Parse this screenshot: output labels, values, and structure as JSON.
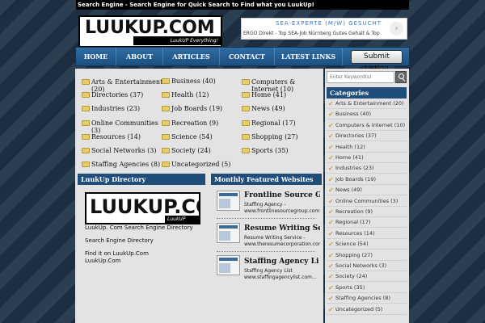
{
  "topbar": {
    "text": "Search Engine - Search Engine for Quick Search to Find what you LuukUp!"
  },
  "logo": {
    "text": "LUUKUP.COM",
    "tagline": "LuukUP Everything!"
  },
  "ad": {
    "title": "SEA-EXPERTE (M/W) GESUCHT",
    "text": "ERGO Direkt - Top SEA-Job Nürnberg Gutes Gehalt & Top Herau...",
    "arrow_icon": "chevron-right-icon"
  },
  "nav": {
    "items": [
      "HOME",
      "ABOUT",
      "ARTICLES",
      "CONTACT",
      "LATEST LINKS"
    ],
    "submit_label": "Submit Listing"
  },
  "categories": [
    "Arts & Entertainment (20)",
    "Business (40)",
    "Computers & Internet (10)",
    "Directories (37)",
    "Health (12)",
    "Home (41)",
    "Industries (23)",
    "Job Boards (19)",
    "News (49)",
    "Online Communities (3)",
    "Recreation (9)",
    "Regional (17)",
    "Resources (14)",
    "Science (54)",
    "Shopping (27)",
    "Social Networks (3)",
    "Society (24)",
    "Sports (35)",
    "Staffing Agencies (8)",
    "Uncategorized (5)"
  ],
  "directory": {
    "heading": "LuukUp Directory",
    "image_text": "LUUKUP.COM",
    "image_tag": "LuukUP Everything!",
    "line1": "LuukUp. Com Search Engine Directory",
    "line2": "Search Engine Directory",
    "line3": "Find it on LuukUp.Com",
    "line4": "LuukUp.Com"
  },
  "featured": {
    "heading": "Monthly Featured Websites",
    "items": [
      {
        "title": "Frontline Source G",
        "desc": "Staffing Agency -",
        "url": "www.frontlinesourcegroup.com..."
      },
      {
        "title": "Resume Writing Ser",
        "desc": "Resume Writing Service -",
        "url": "www.theresumecorporation.com"
      },
      {
        "title": "Staffing Agency Li",
        "desc": "Staffing Agency List",
        "url": "www.staffingagencylist.com..."
      }
    ]
  },
  "sidebar": {
    "search_placeholder": "Enter Keyword(s)",
    "heading": "Categories",
    "items": [
      "Arts & Entertainment (20)",
      "Business (40)",
      "Computers & Internet (10)",
      "Directories (37)",
      "Health (12)",
      "Home (41)",
      "Industries (23)",
      "Job Boards (19)",
      "News (49)",
      "Online Communities (3)",
      "Recreation (9)",
      "Regional (17)",
      "Resources (14)",
      "Science (54)",
      "Shopping (27)",
      "Social Networks (3)",
      "Society (24)",
      "Sports (35)",
      "Staffing Agencies (8)",
      "Uncategorized (5)"
    ]
  },
  "colors": {
    "nav": "#1f4e7a",
    "background": "#1f3247",
    "content": "#e3e3e3",
    "check": "#d4a23a"
  }
}
